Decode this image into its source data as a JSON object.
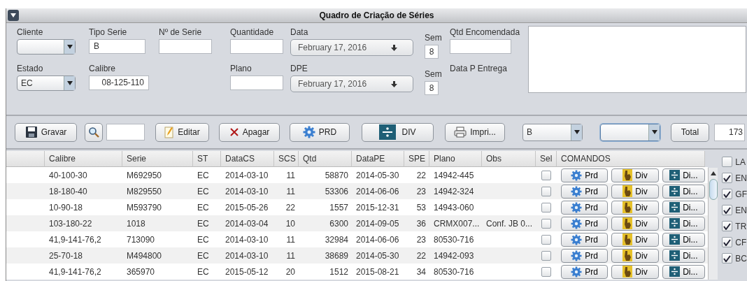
{
  "window": {
    "title": "Quadro de Criação de Séries"
  },
  "form": {
    "top": [
      {
        "kind": "combo",
        "label": "Cliente"
      },
      {
        "kind": "text",
        "label": "Tipo Serie",
        "value": "B"
      },
      {
        "kind": "text",
        "label": "Nº de Serie"
      },
      {
        "kind": "text",
        "label": "Quantidade"
      },
      {
        "kind": "date",
        "label": "Data",
        "value": "February 17, 2016"
      },
      {
        "kind": "week",
        "label": "Sem",
        "value": "8"
      },
      {
        "kind": "text",
        "label": "Qtd Encomendada"
      }
    ],
    "bottom": [
      {
        "kind": "combo",
        "label": "Estado",
        "value": "EC"
      },
      {
        "kind": "text",
        "label": "Calibre",
        "value": "08-125-110"
      },
      {
        "kind": "text",
        "label": "Plano"
      },
      {
        "kind": "date",
        "label": "DPE",
        "value": "February 17, 2016"
      },
      {
        "kind": "week",
        "label": "Sem",
        "value": "8"
      },
      {
        "kind": "label",
        "label": "Data P Entrega"
      }
    ]
  },
  "toolbar": [
    {
      "kind": "button",
      "label": "Gravar"
    },
    {
      "kind": "button"
    },
    {
      "kind": "field"
    },
    {
      "kind": "button",
      "label": "Editar"
    },
    {
      "kind": "button",
      "label": "Apagar"
    },
    {
      "kind": "button",
      "label": "PRD"
    },
    {
      "kind": "button",
      "label": "DIV"
    },
    {
      "kind": "button",
      "label": "Impri..."
    },
    {
      "kind": "combo",
      "value": "B",
      "focused": false
    },
    {
      "kind": "combo",
      "focused": true
    },
    {
      "kind": "button",
      "label": "Total"
    },
    {
      "kind": "total",
      "value": "173"
    }
  ],
  "table": {
    "columns": [
      "",
      "Calibre",
      "Serie",
      "ST",
      "DataCS",
      "SCS",
      "Qtd",
      "DataPE",
      "SPE",
      "Plano",
      "Obs",
      "Sel",
      "COMANDOS"
    ],
    "rows": [
      {
        "cells": [
          "",
          "40-100-30",
          "M692950",
          "EC",
          "2014-03-10",
          "11",
          "58870",
          "2014-05-30",
          "22",
          "14942-445",
          ""
        ],
        "sel": false,
        "commands": [
          "Prd",
          "Div",
          "Di..."
        ]
      },
      {
        "cells": [
          "",
          "18-180-40",
          "M829550",
          "EC",
          "2014-03-10",
          "11",
          "53306",
          "2014-06-06",
          "23",
          "14942-324",
          ""
        ],
        "sel": false,
        "commands": [
          "Prd",
          "Div",
          "Di..."
        ]
      },
      {
        "cells": [
          "",
          "10-90-18",
          "M593790",
          "EC",
          "2015-05-26",
          "22",
          "1557",
          "2015-12-31",
          "53",
          "14943-060",
          ""
        ],
        "sel": false,
        "commands": [
          "Prd",
          "Div",
          "Di..."
        ]
      },
      {
        "cells": [
          "",
          "103-180-22",
          "1018",
          "EC",
          "2014-03-04",
          "10",
          "6300",
          "2014-09-05",
          "36",
          "CRMX007...",
          "Conf. JB 0..."
        ],
        "sel": false,
        "commands": [
          "Prd",
          "Div",
          "Di..."
        ]
      },
      {
        "cells": [
          "",
          "41,9-141-76,2",
          "713090",
          "EC",
          "2014-03-10",
          "11",
          "32984",
          "2014-06-06",
          "23",
          "80530-716",
          ""
        ],
        "sel": false,
        "commands": [
          "Prd",
          "Div",
          "Di..."
        ]
      },
      {
        "cells": [
          "",
          "25-70-18",
          "M494800",
          "EC",
          "2014-03-10",
          "11",
          "38689",
          "2014-05-30",
          "22",
          "14942-093",
          ""
        ],
        "sel": false,
        "commands": [
          "Prd",
          "Div",
          "Di..."
        ]
      },
      {
        "cells": [
          "",
          "41,9-141-76,2",
          "365970",
          "EC",
          "2015-05-12",
          "20",
          "1512",
          "2015-08-21",
          "34",
          "80530-716",
          ""
        ],
        "sel": false,
        "commands": [
          "Prd",
          "Div",
          "Di..."
        ]
      }
    ]
  },
  "filters": [
    {
      "label": "LA",
      "checked": false
    },
    {
      "label": "EN",
      "checked": true
    },
    {
      "label": "GF",
      "checked": true
    },
    {
      "label": "EN",
      "checked": true
    },
    {
      "label": "TR",
      "checked": true
    },
    {
      "label": "CF",
      "checked": true
    },
    {
      "label": "BC",
      "checked": true
    }
  ]
}
